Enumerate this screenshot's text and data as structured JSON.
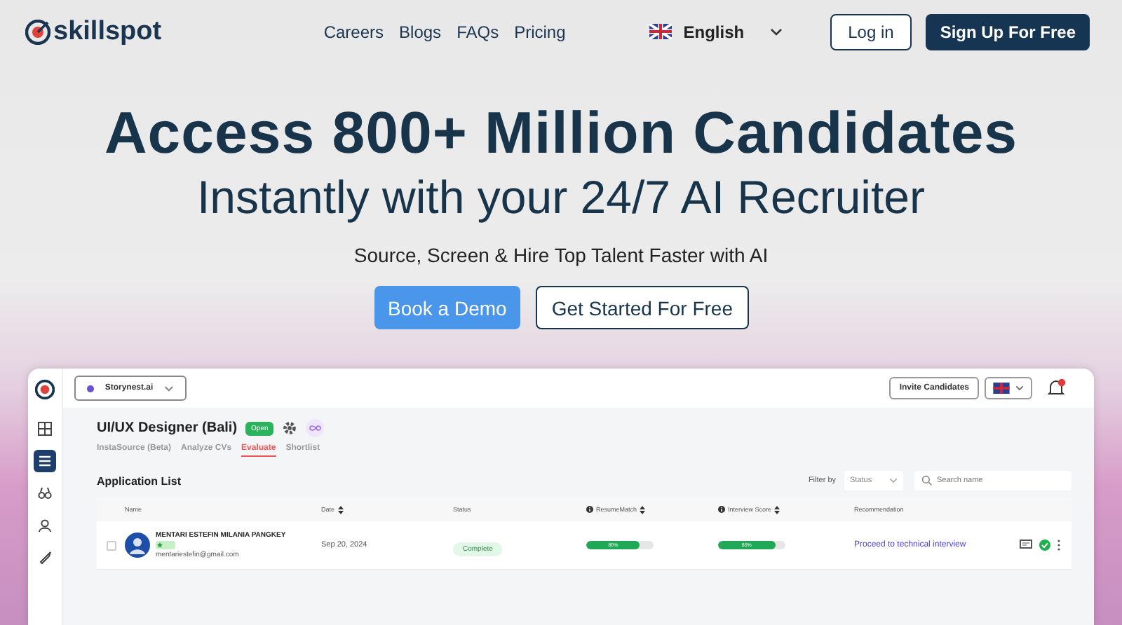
{
  "header": {
    "brand": "skillspot",
    "nav": [
      "Careers",
      "Blogs",
      "FAQs",
      "Pricing"
    ],
    "language": "English",
    "login": "Log in",
    "signup": "Sign Up For Free"
  },
  "hero": {
    "title": "Access 800+ Million Candidates",
    "subtitle": "Instantly with your 24/7 AI Recruiter",
    "tagline": "Source, Screen & Hire Top Talent Faster with AI",
    "buttons": [
      {
        "label": "Book a Demo",
        "kind": "primary"
      },
      {
        "label": "Get Started For Free",
        "kind": "secondary"
      }
    ]
  },
  "app": {
    "sidebar": [
      {
        "selected": false
      },
      {
        "selected": true
      },
      {
        "selected": false
      },
      {
        "selected": false
      },
      {
        "selected": false
      }
    ],
    "workspace": "Storynest.ai",
    "invite": "Invite Candidates",
    "job": {
      "title": "UI/UX Designer (Bali)",
      "status": "Open"
    },
    "tabs": [
      {
        "label": "InstaSource (Beta)",
        "selected": false
      },
      {
        "label": "Analyze CVs",
        "selected": false
      },
      {
        "label": "Evaluate",
        "selected": true
      },
      {
        "label": "Shortlist",
        "selected": false
      }
    ],
    "list_title": "Application List",
    "filter_label": "Filter by",
    "filter_value": "Status",
    "search": {
      "placeholder": "Search name"
    },
    "columns": [
      {
        "label": "Name",
        "sortable": false,
        "info": false
      },
      {
        "label": "Date",
        "sortable": true,
        "info": false
      },
      {
        "label": "Status",
        "sortable": false,
        "info": false
      },
      {
        "label": "ResumeMatch",
        "sortable": true,
        "info": true
      },
      {
        "label": "Interview Score",
        "sortable": true,
        "info": true
      },
      {
        "label": "Recommendation",
        "sortable": false,
        "info": false
      }
    ],
    "rows": [
      {
        "name": "MENTARI ESTEFIN MILANIA PANGKEY",
        "email": "mentariestefin@gmail.com",
        "date": "Sep 20, 2024",
        "status": "Complete",
        "resume": {
          "level": 0.8,
          "reading": "80%"
        },
        "interview": {
          "level": 0.85,
          "reading": "85%"
        },
        "recommendation": "Proceed to technical interview",
        "checked": false
      }
    ]
  }
}
